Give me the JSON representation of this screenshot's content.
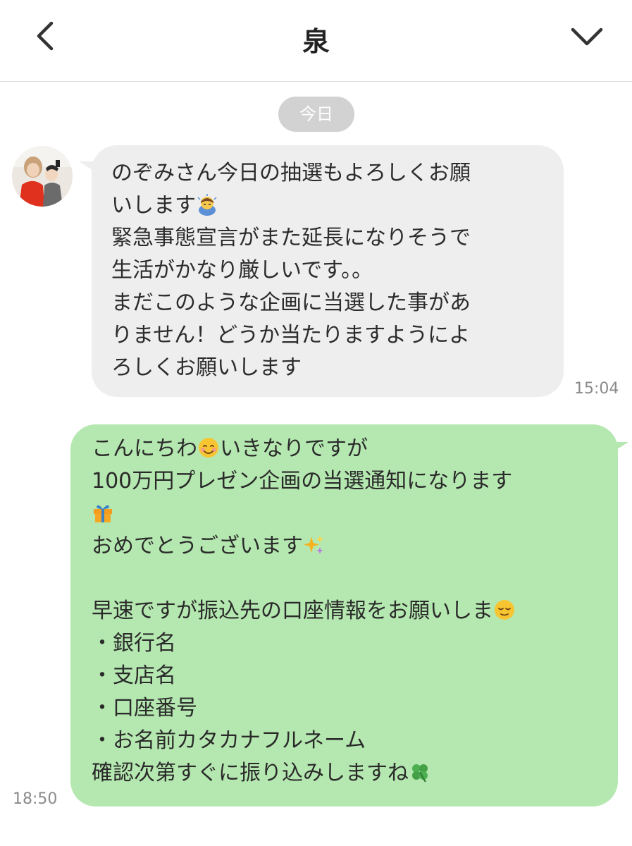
{
  "header": {
    "title": "泉"
  },
  "date_separator": "今日",
  "messages": {
    "incoming": {
      "lines": [
        "のぞみさん今日の抽選もよろしくお願",
        "いします",
        "緊急事態宣言がまた延長になりそうで",
        "生活がかなり厳しいです。。",
        "まだこのような企画に当選した事があ",
        "りません！どうか当たりますようによ",
        "ろしくお願いします"
      ],
      "time": "15:04"
    },
    "outgoing": {
      "l1a": "こんにちわ",
      "l1b": "いきなりですが",
      "l2": "100万円プレゼン企画の当選通知になります",
      "l4": "おめでとうございます",
      "l6": "早速ですが振込先の口座情報をお願いしま",
      "l7": "・銀行名",
      "l8": "・支店名",
      "l9": "・口座番号",
      "l10": "・お名前カタカナフルネーム",
      "l11": "確認次第すぐに振り込みしますね",
      "time": "18:50"
    }
  },
  "icons": {
    "back": "chevron-left-icon",
    "menu": "chevron-down-icon",
    "emoji_bow": "person-bowing-emoji",
    "emoji_smile": "smiling-face-emoji",
    "emoji_gift": "wrapped-gift-emoji",
    "emoji_sparkles": "sparkles-emoji",
    "emoji_relieved": "relieved-face-emoji",
    "emoji_clover": "four-leaf-clover-emoji"
  },
  "colors": {
    "incoming_bubble": "#eeeeef",
    "outgoing_bubble": "#b5e8b0",
    "date_pill": "#d2d2d2"
  }
}
